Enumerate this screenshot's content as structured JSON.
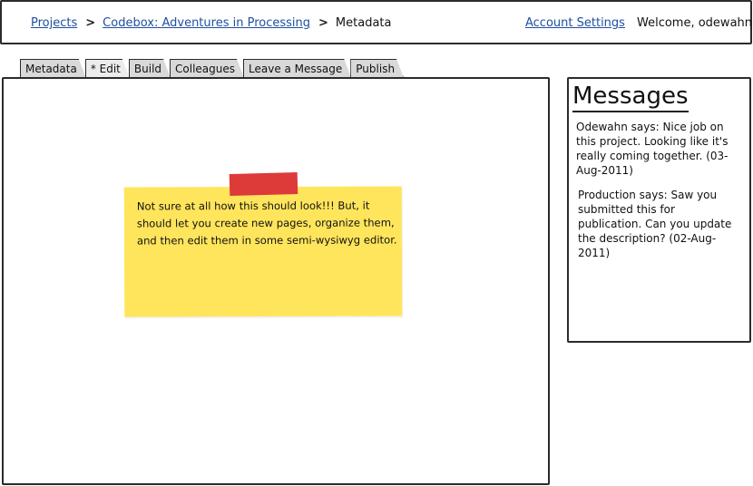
{
  "header": {
    "breadcrumb": [
      {
        "label": "Projects",
        "link": true
      },
      {
        "label": "Codebox: Adventures in Processing",
        "link": true
      },
      {
        "label": "Metadata",
        "link": false
      }
    ],
    "separator": ">",
    "account_settings": "Account Settings",
    "welcome": "Welcome, odewahn"
  },
  "tabs": [
    {
      "label": "Metadata",
      "active": false
    },
    {
      "label": "* Edit",
      "active": true
    },
    {
      "label": "Build",
      "active": false
    },
    {
      "label": "Colleagues",
      "active": false
    },
    {
      "label": "Leave a Message",
      "active": false
    },
    {
      "label": "Publish",
      "active": false
    }
  ],
  "main": {
    "sticky_note_text": "Not sure at all how this should look!!!  But, it should let you create new pages, organize them, and then edit them in some semi-wysiwyg editor."
  },
  "messages": {
    "title": "Messages",
    "items": [
      {
        "text": "Odewahn says: Nice job on this project.  Looking like it's really coming together. (03-Aug-2011)"
      },
      {
        "text": "Production says: Saw you submitted this for publication. Can you update the description? (02-Aug-2011)"
      }
    ]
  },
  "colors": {
    "link": "#1f4fa0",
    "sticky_note": "#ffe55c",
    "tape": "#dd3a3a",
    "tab_bg": "#d9d9d9",
    "border": "#2b2b2b"
  }
}
